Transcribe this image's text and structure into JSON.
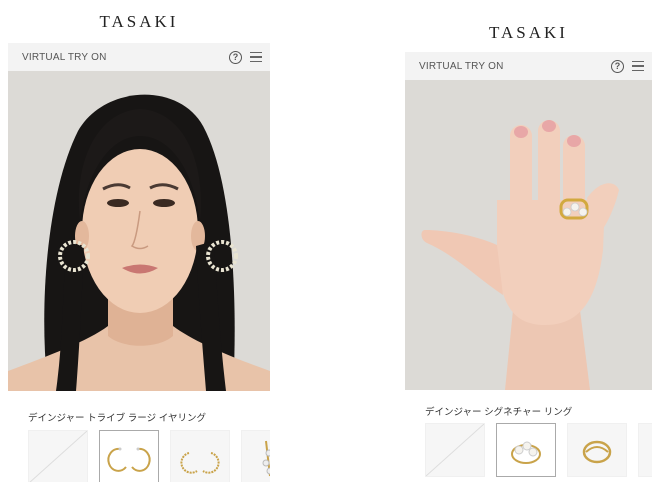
{
  "left_panel": {
    "brand": "TASAKI",
    "header": {
      "title": "VIRTUAL TRY ON",
      "help_symbol": "?"
    },
    "product_name": "デインジャー トライブ ラージ イヤリング",
    "thumbnails": [
      "none",
      "hoop-earring-gold",
      "spiked-hoop-earring",
      "pearl-cluster-earring"
    ]
  },
  "right_panel": {
    "brand": "TASAKI",
    "header": {
      "title": "VIRTUAL TRY ON",
      "help_symbol": "?"
    },
    "product_name": "デインジャー シグネチャー リング",
    "thumbnails": [
      "none",
      "pearl-ring-selected",
      "gold-wave-ring",
      "pearl-ring-partial"
    ]
  }
}
